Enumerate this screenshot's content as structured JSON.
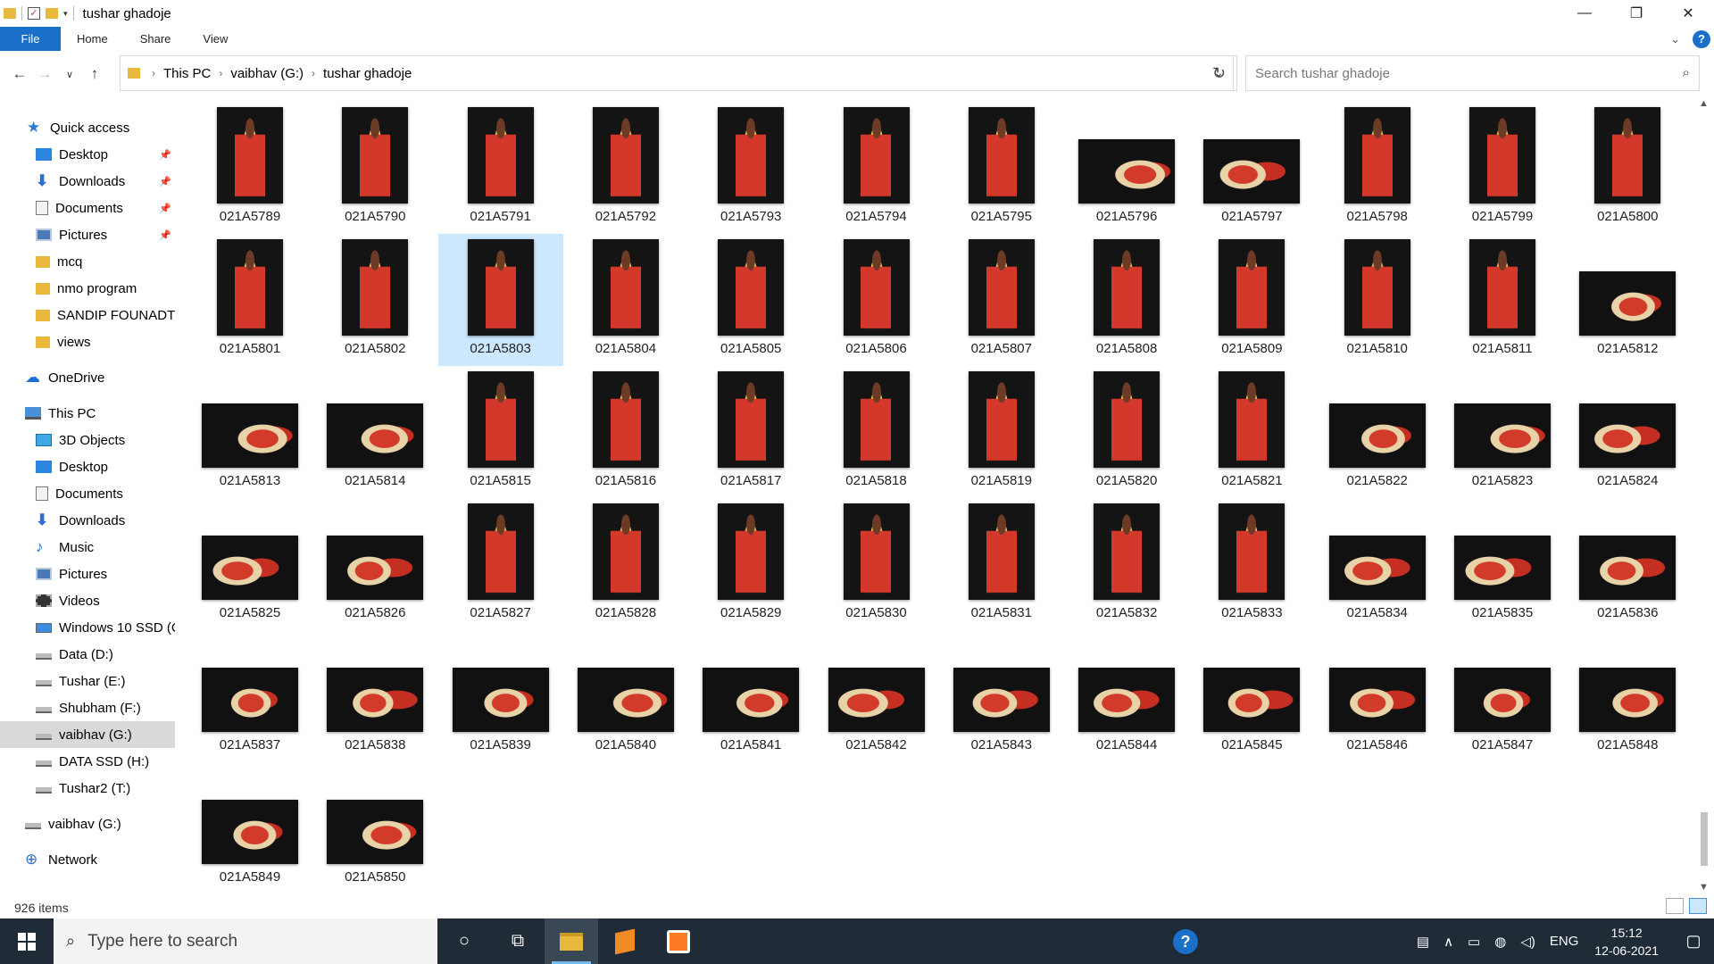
{
  "window": {
    "title": "tushar ghadoje",
    "controls": {
      "minimize": "—",
      "maximize": "❐",
      "close": "✕"
    }
  },
  "ribbon": {
    "tabs": [
      "File",
      "Home",
      "Share",
      "View"
    ],
    "help": "?"
  },
  "address": {
    "breadcrumbs": [
      "This PC",
      "vaibhav  (G:)",
      "tushar ghadoje"
    ],
    "search_placeholder": "Search tushar ghadoje"
  },
  "sidebar": {
    "items": [
      {
        "label": "Quick access",
        "icon": "star-icon",
        "pinned": false
      },
      {
        "label": "Desktop",
        "icon": "desktop-icon",
        "pinned": true
      },
      {
        "label": "Downloads",
        "icon": "downloads-icon",
        "pinned": true
      },
      {
        "label": "Documents",
        "icon": "documents-icon",
        "pinned": true
      },
      {
        "label": "Pictures",
        "icon": "pictures-icon",
        "pinned": true
      },
      {
        "label": "mcq",
        "icon": "folder-icon",
        "pinned": false
      },
      {
        "label": "nmo program",
        "icon": "folder-icon",
        "pinned": false
      },
      {
        "label": "SANDIP FOUNADTIO",
        "icon": "folder-icon",
        "pinned": false
      },
      {
        "label": "views",
        "icon": "folder-icon",
        "pinned": false
      },
      {
        "label": "OneDrive",
        "icon": "onedrive-icon",
        "pinned": false
      },
      {
        "label": "This PC",
        "icon": "this-pc-icon",
        "pinned": false
      },
      {
        "label": "3D Objects",
        "icon": "3d-objects-icon",
        "pinned": false
      },
      {
        "label": "Desktop",
        "icon": "desktop-icon",
        "pinned": false
      },
      {
        "label": "Documents",
        "icon": "documents-icon",
        "pinned": false
      },
      {
        "label": "Downloads",
        "icon": "downloads-icon",
        "pinned": false
      },
      {
        "label": "Music",
        "icon": "music-icon",
        "pinned": false
      },
      {
        "label": "Pictures",
        "icon": "pictures-icon",
        "pinned": false
      },
      {
        "label": "Videos",
        "icon": "videos-icon",
        "pinned": false
      },
      {
        "label": "Windows 10 SSD (C",
        "icon": "windows-drive-icon",
        "pinned": false
      },
      {
        "label": "Data (D:)",
        "icon": "drive-icon",
        "pinned": false
      },
      {
        "label": "Tushar (E:)",
        "icon": "drive-icon",
        "pinned": false
      },
      {
        "label": "Shubham (F:)",
        "icon": "drive-icon",
        "pinned": false
      },
      {
        "label": "vaibhav  (G:)",
        "icon": "drive-icon",
        "pinned": false,
        "selected": true
      },
      {
        "label": "DATA SSD (H:)",
        "icon": "drive-icon",
        "pinned": false
      },
      {
        "label": "Tushar2 (T:)",
        "icon": "drive-icon",
        "pinned": false
      },
      {
        "label": "vaibhav  (G:)",
        "icon": "drive-icon",
        "pinned": false
      },
      {
        "label": "Network",
        "icon": "network-icon",
        "pinned": false
      }
    ]
  },
  "files": [
    {
      "name": "021A5789",
      "orientation": "portrait"
    },
    {
      "name": "021A5790",
      "orientation": "portrait"
    },
    {
      "name": "021A5791",
      "orientation": "portrait"
    },
    {
      "name": "021A5792",
      "orientation": "portrait"
    },
    {
      "name": "021A5793",
      "orientation": "portrait"
    },
    {
      "name": "021A5794",
      "orientation": "portrait"
    },
    {
      "name": "021A5795",
      "orientation": "portrait"
    },
    {
      "name": "021A5796",
      "orientation": "landscape"
    },
    {
      "name": "021A5797",
      "orientation": "landscape"
    },
    {
      "name": "021A5798",
      "orientation": "portrait"
    },
    {
      "name": "021A5799",
      "orientation": "portrait"
    },
    {
      "name": "021A5800",
      "orientation": "portrait"
    },
    {
      "name": "021A5801",
      "orientation": "portrait"
    },
    {
      "name": "021A5802",
      "orientation": "portrait"
    },
    {
      "name": "021A5803",
      "orientation": "portrait",
      "selected": true
    },
    {
      "name": "021A5804",
      "orientation": "portrait"
    },
    {
      "name": "021A5805",
      "orientation": "portrait"
    },
    {
      "name": "021A5806",
      "orientation": "portrait"
    },
    {
      "name": "021A5807",
      "orientation": "portrait"
    },
    {
      "name": "021A5808",
      "orientation": "portrait"
    },
    {
      "name": "021A5809",
      "orientation": "portrait"
    },
    {
      "name": "021A5810",
      "orientation": "portrait"
    },
    {
      "name": "021A5811",
      "orientation": "portrait"
    },
    {
      "name": "021A5812",
      "orientation": "landscape"
    },
    {
      "name": "021A5813",
      "orientation": "landscape"
    },
    {
      "name": "021A5814",
      "orientation": "landscape"
    },
    {
      "name": "021A5815",
      "orientation": "portrait"
    },
    {
      "name": "021A5816",
      "orientation": "portrait"
    },
    {
      "name": "021A5817",
      "orientation": "portrait"
    },
    {
      "name": "021A5818",
      "orientation": "portrait"
    },
    {
      "name": "021A5819",
      "orientation": "portrait"
    },
    {
      "name": "021A5820",
      "orientation": "portrait"
    },
    {
      "name": "021A5821",
      "orientation": "portrait"
    },
    {
      "name": "021A5822",
      "orientation": "landscape"
    },
    {
      "name": "021A5823",
      "orientation": "landscape"
    },
    {
      "name": "021A5824",
      "orientation": "landscape"
    },
    {
      "name": "021A5825",
      "orientation": "landscape"
    },
    {
      "name": "021A5826",
      "orientation": "landscape"
    },
    {
      "name": "021A5827",
      "orientation": "portrait"
    },
    {
      "name": "021A5828",
      "orientation": "portrait"
    },
    {
      "name": "021A5829",
      "orientation": "portrait"
    },
    {
      "name": "021A5830",
      "orientation": "portrait"
    },
    {
      "name": "021A5831",
      "orientation": "portrait"
    },
    {
      "name": "021A5832",
      "orientation": "portrait"
    },
    {
      "name": "021A5833",
      "orientation": "portrait"
    },
    {
      "name": "021A5834",
      "orientation": "landscape"
    },
    {
      "name": "021A5835",
      "orientation": "landscape"
    },
    {
      "name": "021A5836",
      "orientation": "landscape"
    },
    {
      "name": "021A5837",
      "orientation": "landscape"
    },
    {
      "name": "021A5838",
      "orientation": "landscape"
    },
    {
      "name": "021A5839",
      "orientation": "landscape"
    },
    {
      "name": "021A5840",
      "orientation": "landscape"
    },
    {
      "name": "021A5841",
      "orientation": "landscape"
    },
    {
      "name": "021A5842",
      "orientation": "landscape"
    },
    {
      "name": "021A5843",
      "orientation": "landscape"
    },
    {
      "name": "021A5844",
      "orientation": "landscape"
    },
    {
      "name": "021A5845",
      "orientation": "landscape"
    },
    {
      "name": "021A5846",
      "orientation": "landscape"
    },
    {
      "name": "021A5847",
      "orientation": "landscape"
    },
    {
      "name": "021A5848",
      "orientation": "landscape"
    },
    {
      "name": "021A5849",
      "orientation": "landscape"
    },
    {
      "name": "021A5850",
      "orientation": "landscape"
    }
  ],
  "status": {
    "item_count": "926 items"
  },
  "taskbar": {
    "search_placeholder": "Type here to search",
    "language": "ENG",
    "time": "15:12",
    "date": "12-06-2021",
    "help_label": "?"
  },
  "colors": {
    "accent": "#1a6fc9",
    "selection": "#cce8ff",
    "taskbar": "#1f2b37",
    "folder": "#e8b93c"
  }
}
